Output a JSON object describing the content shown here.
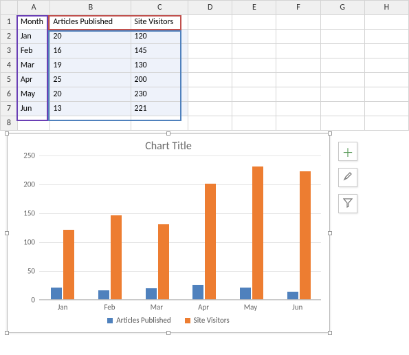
{
  "columns": [
    "A",
    "B",
    "C",
    "D",
    "E",
    "F",
    "G",
    "H"
  ],
  "rows": [
    "1",
    "2",
    "3",
    "4",
    "5",
    "6",
    "7",
    "8"
  ],
  "headers": {
    "A1": "Month",
    "B1": "Articles Published",
    "C1": "Site Visitors"
  },
  "data": [
    {
      "month": "Jan",
      "articles": "20",
      "visitors": "120"
    },
    {
      "month": "Feb",
      "articles": "16",
      "visitors": "145"
    },
    {
      "month": "Mar",
      "articles": "19",
      "visitors": "130"
    },
    {
      "month": "Apr",
      "articles": "25",
      "visitors": "200"
    },
    {
      "month": "May",
      "articles": "20",
      "visitors": "230"
    },
    {
      "month": "Jun",
      "articles": "13",
      "visitors": "221"
    }
  ],
  "chart_title": "Chart Title",
  "legend": {
    "s1": "Articles Published",
    "s2": "Site Visitors"
  },
  "yticks": [
    "0",
    "50",
    "100",
    "150",
    "200",
    "250"
  ],
  "chart_data": {
    "type": "bar",
    "title": "Chart Title",
    "categories": [
      "Jan",
      "Feb",
      "Mar",
      "Apr",
      "May",
      "Jun"
    ],
    "series": [
      {
        "name": "Articles Published",
        "values": [
          20,
          16,
          19,
          25,
          20,
          13
        ]
      },
      {
        "name": "Site Visitors",
        "values": [
          120,
          145,
          130,
          200,
          230,
          221
        ]
      }
    ],
    "xlabel": "",
    "ylabel": "",
    "ylim": [
      0,
      250
    ],
    "grid": true,
    "legend_position": "bottom"
  }
}
